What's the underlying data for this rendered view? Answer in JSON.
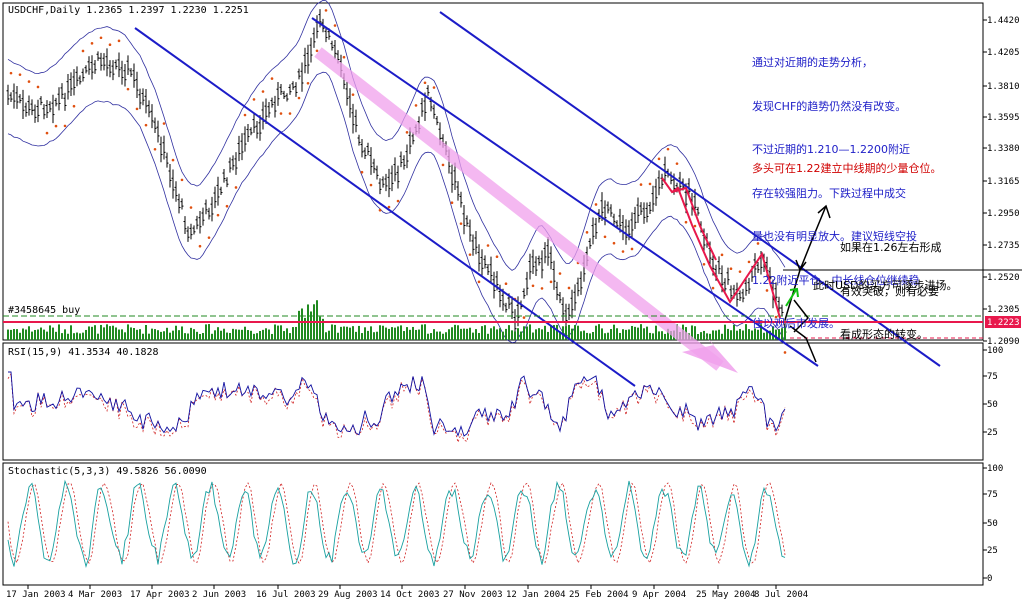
{
  "main_panel": {
    "header": "USDCHF,Daily  1.2365 1.2397 1.2230 1.2251",
    "volume_label": "#3458645 buy",
    "current_price_tag": "1.2223",
    "price_axis": [
      "1.4420",
      "1.4205",
      "1.3810",
      "1.3595",
      "1.3380",
      "1.3165",
      "1.2950",
      "1.2735",
      "1.2520",
      "1.2305",
      "1.2090"
    ]
  },
  "rsi_panel": {
    "header": "RSI(15,9) 41.3534  40.1828",
    "axis": [
      "100",
      "75",
      "50",
      "25"
    ]
  },
  "stoch_panel": {
    "header": "Stochastic(5,3,3) 49.5826  56.0090",
    "axis": [
      "100",
      "75",
      "50",
      "25",
      "0"
    ]
  },
  "date_axis": [
    "17 Jan 2003",
    "4 Mar 2003",
    "17 Apr 2003",
    "2 Jun 2003",
    "16 Jul 2003",
    "29 Aug 2003",
    "14 Oct 2003",
    "27 Nov 2003",
    "12 Jan 2004",
    "25 Feb 2004",
    "9 Apr 2004",
    "25 May 2004",
    "8 Jul 2004"
  ],
  "annotations": {
    "analysis_lines": [
      "通过对近期的走势分析，",
      "发现CHF的趋势仍然没有改变。",
      "不过近期的1.210—1.2200附近",
      "存在较强阻力。下跌过程中成交",
      "量也没有明显放大。建议短线空投",
      "1.22附近平仓，中长线仓位继续稳",
      "住以观后市发展。"
    ],
    "long_position_note": "多头可在1.22建立中线期的少量仓位。",
    "breakout_lines": [
      "如果在1.26左右形成",
      "有效突破，则有必要",
      "看成形态的转变。"
    ],
    "usd_buy_note": "此时USD的买方可逐步进场。"
  },
  "colors": {
    "channel": "#1c1cc8",
    "trend_arrow": "#f0a0ec",
    "price_line": "#e8184c",
    "volume": "#208a20",
    "sar": "#e05010",
    "rsi": "#1010a0",
    "stoch_main": "#18a0a0",
    "stoch_signal": "#d02020"
  }
}
